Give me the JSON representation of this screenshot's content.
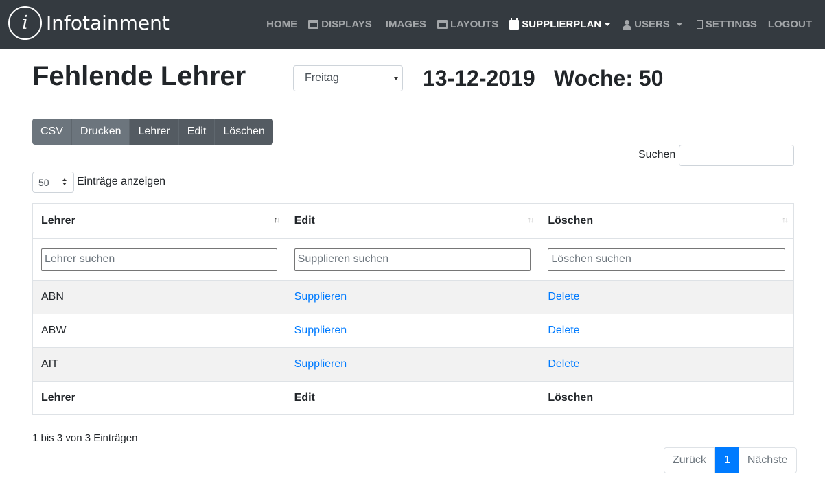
{
  "brand": {
    "logo_letter": "i",
    "name": "Infotainment"
  },
  "nav": {
    "home": "HOME",
    "displays": "DISPLAYS",
    "images": "IMAGES",
    "layouts": "LAYOUTS",
    "supplierplan": "SUPPLIERPLAN",
    "users": "USERS",
    "settings": "SETTINGS",
    "logout": "LOGOUT"
  },
  "header": {
    "title": "Fehlende Lehrer",
    "day_selected": "Freitag",
    "date": "13-12-2019",
    "week": "Woche: 50"
  },
  "buttons": {
    "csv": "CSV",
    "print": "Drucken",
    "lehrer": "Lehrer",
    "edit": "Edit",
    "delete": "Löschen"
  },
  "search": {
    "label": "Suchen",
    "value": ""
  },
  "length": {
    "value": "50",
    "label": "Einträge anzeigen"
  },
  "table": {
    "columns": [
      "Lehrer",
      "Edit",
      "Löschen"
    ],
    "filters": [
      "Lehrer suchen",
      "Supplieren suchen",
      "Löschen suchen"
    ],
    "rows": [
      {
        "lehrer": "ABN",
        "edit": "Supplieren",
        "delete": "Delete"
      },
      {
        "lehrer": "ABW",
        "edit": "Supplieren",
        "delete": "Delete"
      },
      {
        "lehrer": "AIT",
        "edit": "Supplieren",
        "delete": "Delete"
      }
    ],
    "footer": [
      "Lehrer",
      "Edit",
      "Löschen"
    ]
  },
  "info": "1 bis 3 von 3 Einträgen",
  "pagination": {
    "prev": "Zurück",
    "current": "1",
    "next": "Nächste"
  },
  "colors": {
    "navbar": "#343a40",
    "primary": "#007bff",
    "secondary": "#6c757d"
  }
}
